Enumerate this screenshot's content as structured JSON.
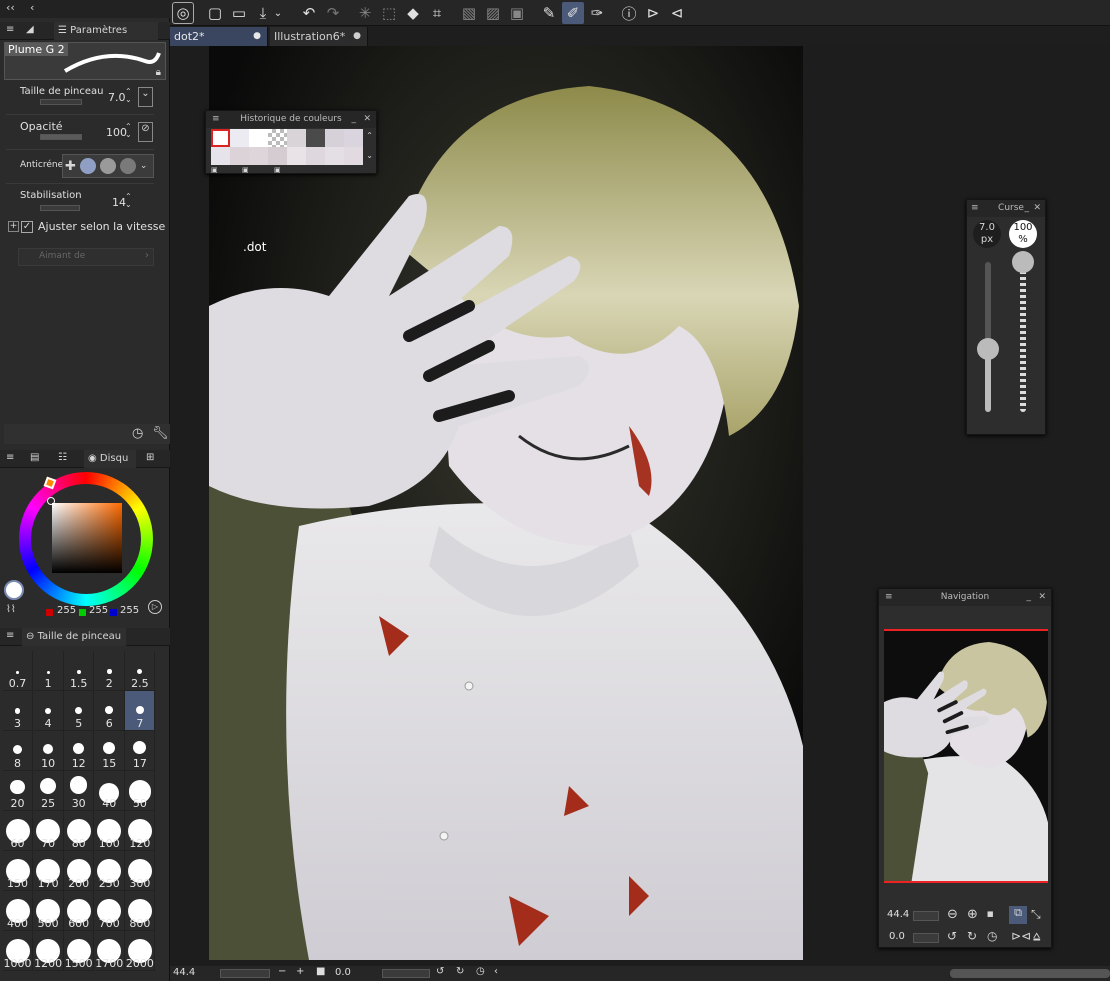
{
  "toolbar": {
    "tabs": [
      {
        "label": "dot2*",
        "dot": "●"
      },
      {
        "label": "Illustration6*",
        "dot": "●"
      }
    ]
  },
  "tool_settings": {
    "tab_title": "Paramètres d'outil",
    "brush_name": "Plume G 2",
    "brush_size_label": "Taille de pinceau",
    "brush_size_value": "7.0",
    "opacity_label": "Opacité",
    "opacity_value": "100",
    "antialias_label": "Anticrénela",
    "stabilization_label": "Stabilisation",
    "stabilization_value": "14",
    "speed_label": "Ajuster selon la vitesse",
    "snap_label": "Aimant de"
  },
  "color_panel": {
    "tab_title": "Disqu",
    "r": "255",
    "g": "255",
    "b": "255"
  },
  "brush_size_panel": {
    "title": "Taille de pinceau",
    "sizes": [
      "0.7",
      "1",
      "1.5",
      "2",
      "2.5",
      "3",
      "4",
      "5",
      "6",
      "7",
      "8",
      "10",
      "12",
      "15",
      "17",
      "20",
      "25",
      "30",
      "40",
      "50",
      "60",
      "70",
      "80",
      "100",
      "120",
      "150",
      "170",
      "200",
      "250",
      "300",
      "400",
      "500",
      "600",
      "700",
      "800",
      "1000",
      "1200",
      "1500",
      "1700",
      "2000"
    ],
    "selected": "7"
  },
  "color_history": {
    "title": "Historique de couleurs"
  },
  "cursor_panel": {
    "title": "Curse",
    "size_value": "7.0",
    "size_unit": "px",
    "opacity_value": "100",
    "opacity_unit": "%"
  },
  "navigation": {
    "title": "Navigation",
    "zoom": "44.4",
    "rotation": "0.0"
  },
  "canvas": {
    "layer_text": ".dot"
  },
  "status": {
    "zoom": "44.4",
    "angle": "0.0"
  },
  "colors": {
    "accent": "#4b5a78",
    "panel": "#2b2b2b",
    "bg": "#1d1d1d"
  }
}
